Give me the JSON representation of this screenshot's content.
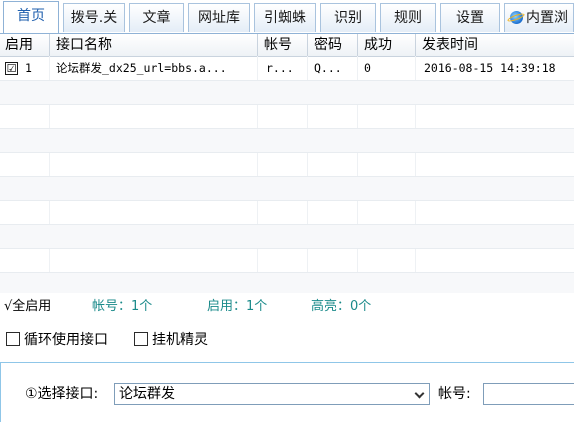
{
  "tabs": [
    {
      "label": "首页",
      "active": true
    },
    {
      "label": "拨号.关"
    },
    {
      "label": "文章"
    },
    {
      "label": "网址库"
    },
    {
      "label": "引蜘蛛"
    },
    {
      "label": "识别"
    },
    {
      "label": "规则"
    },
    {
      "label": "设置"
    },
    {
      "label": "内置浏",
      "icon": "ie-browser-icon"
    }
  ],
  "grid": {
    "headers": [
      "启用",
      "接口名称",
      "帐号",
      "密码",
      "成功",
      "发表时间"
    ],
    "rows": [
      {
        "enabled": "☑",
        "index": "1",
        "name": "论坛群发_dx25_url=bbs.a...",
        "account": "r...",
        "password": "Q...",
        "success": "0",
        "time": "2016-08-15 14:39:18"
      }
    ]
  },
  "status": {
    "all_enable": "√全启用",
    "accounts": "帐号：1个",
    "enabled": "启用：1个",
    "highlight": "高亮：0个"
  },
  "options": {
    "loop_label": "循环使用接口",
    "hang_label": "挂机精灵"
  },
  "panel": {
    "select_label": "①选择接口:",
    "select_value": "论坛群发",
    "account_label": "帐号:",
    "account_value": ""
  },
  "colors": {
    "accent": "#1f5fae",
    "teal": "#1a8a8a",
    "panel_border": "#8fc6e8"
  }
}
